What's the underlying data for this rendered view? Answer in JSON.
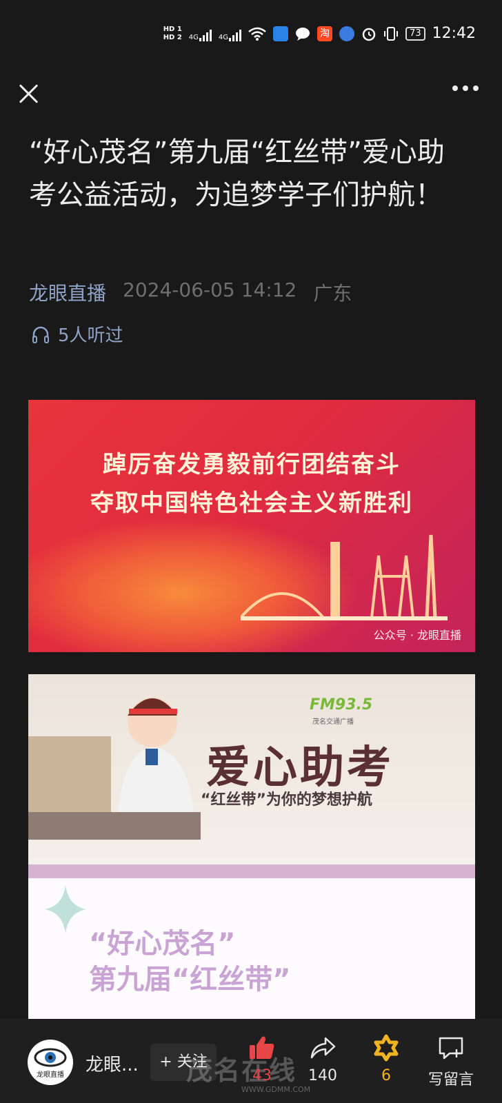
{
  "status_bar": {
    "hd1": "HD 1",
    "hd2": "HD 2",
    "net1": "4G",
    "net2": "4G",
    "taobao_icon": "淘",
    "battery": "73",
    "time": "12:42"
  },
  "nav": {
    "close_icon": "close-icon",
    "more_icon": "more-icon"
  },
  "article": {
    "title": "“好心茂名”第九届“红丝带”爱心助考公益活动，为追梦学子们护航！",
    "source": "龙眼直播",
    "datetime": "2024-06-05 14:12",
    "location": "广东",
    "listeners": "5人听过"
  },
  "banner1": {
    "slogan_line1": "踔厉奋发勇毅前行团结奋斗",
    "slogan_line2": "夺取中国特色社会主义新胜利",
    "watermark": "公众号 · 龙眼直播"
  },
  "banner2": {
    "fm": "FM93.5",
    "fm_sub": "茂名交通广播",
    "heading": "爱心助考",
    "subheading": "“红丝带”为你的梦想护航",
    "line1": "“好心茂名”",
    "line2": "第九届“红丝带”"
  },
  "bottom_bar": {
    "account_name": "龙眼...",
    "avatar_text": "龙眼直播",
    "follow_label": "+ 关注",
    "like_count": "43",
    "share_count": "140",
    "favorite_count": "6",
    "comment_label": "写留言",
    "watermark_text": "茂名在线",
    "watermark_url": "WWW.GDMM.COM"
  },
  "colors": {
    "background": "#191919",
    "link_blue": "#8fa3c7",
    "like_red": "#e84646",
    "favorite_gold": "#f1b321"
  }
}
